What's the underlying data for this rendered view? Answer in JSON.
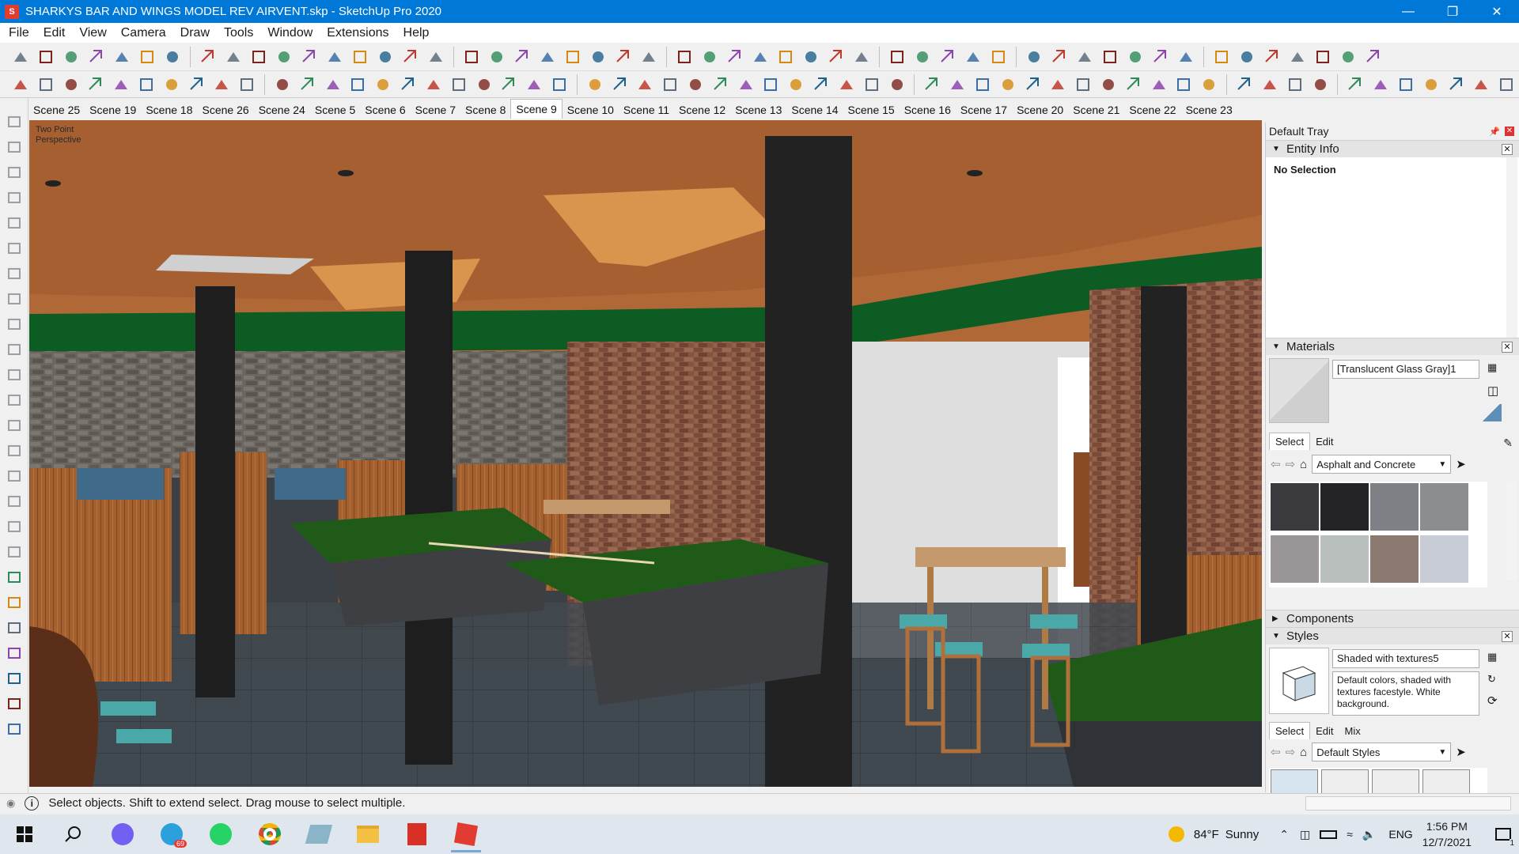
{
  "window": {
    "title": "SHARKYS  BAR AND WINGS MODEL REV AIRVENT.skp - SketchUp Pro 2020",
    "controls": [
      "minimize-icon",
      "restore-icon",
      "close-icon"
    ]
  },
  "menu": [
    "File",
    "Edit",
    "View",
    "Camera",
    "Draw",
    "Tools",
    "Window",
    "Extensions",
    "Help"
  ],
  "scenes": [
    "Scene 25",
    "Scene 19",
    "Scene 18",
    "Scene 26",
    "Scene 24",
    "Scene 5",
    "Scene 6",
    "Scene 7",
    "Scene 8",
    "Scene 9",
    "Scene 10",
    "Scene 11",
    "Scene 12",
    "Scene 13",
    "Scene 14",
    "Scene 15",
    "Scene 16",
    "Scene 17",
    "Scene 20",
    "Scene 21",
    "Scene 22",
    "Scene 23"
  ],
  "active_scene": "Scene 9",
  "viewport": {
    "label_line1": "Two Point",
    "label_line2": "Perspective"
  },
  "tray": {
    "title": "Default Tray",
    "entity_info": {
      "heading": "Entity Info",
      "value": "No Selection"
    },
    "materials": {
      "heading": "Materials",
      "current": "[Translucent Glass Gray]1",
      "tabs": [
        "Select",
        "Edit"
      ],
      "library": "Asphalt and Concrete",
      "swatch_colors": [
        "#3b3a3f",
        "#242426",
        "#7d8186",
        "#8b8d90",
        "#9a9697",
        "#b8bfbd",
        "#8a7a72",
        "#c8ccd4"
      ]
    },
    "components": {
      "heading": "Components"
    },
    "styles": {
      "heading": "Styles",
      "current": "Shaded with textures5",
      "description": "Default colors, shaded with textures facestyle. White background.",
      "tabs": [
        "Select",
        "Edit",
        "Mix"
      ],
      "library": "Default Styles"
    }
  },
  "status": {
    "message": "Select objects. Shift to extend select. Drag mouse to select multiple."
  },
  "taskbar": {
    "weather_temp": "84°F",
    "weather_desc": "Sunny",
    "language": "ENG",
    "time": "1:56 PM",
    "date": "12/7/2021",
    "telegram_badge": "69",
    "notification_count": "1"
  },
  "colors": {
    "accent": "#0078d7",
    "ceiling_wood": "#b36a36",
    "wall_green": "#0d5c24",
    "felt_green": "#1f5a18",
    "floor": "#3d444b"
  }
}
